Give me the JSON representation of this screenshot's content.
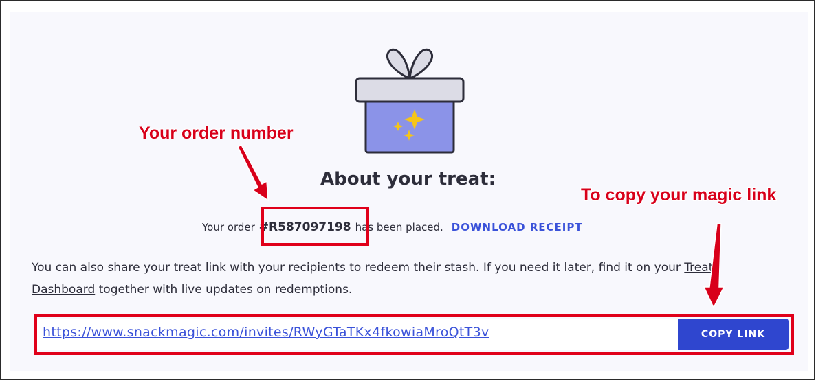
{
  "heading": "About your treat:",
  "order": {
    "prefix": "Your order",
    "number": "#R587097198",
    "suffix": "has been placed.",
    "download_label": "DOWNLOAD RECEIPT"
  },
  "description": {
    "before_link": "You can also share your treat link with your recipients to redeem their stash. If you need it later, find it on your ",
    "link_text": "Treats Dashboard",
    "after_link": " together with live updates on redemptions."
  },
  "magic_link": {
    "url": "https://www.snackmagic.com/invites/RWyGTaTKx4fkowiaMroQtT3v",
    "copy_label": "COPY LINK"
  },
  "annotations": {
    "order_number": "Your order number",
    "copy_link": "To copy your magic link"
  },
  "colors": {
    "accent": "#3a52d9",
    "button": "#2f46cf",
    "annotation": "#e0001a",
    "gift_box": "#8b93e8",
    "gift_lid": "#dcdce6",
    "sparkle": "#f5c518"
  },
  "icons": [
    "gift-icon",
    "sparkle-icon",
    "arrow-down-icon"
  ]
}
